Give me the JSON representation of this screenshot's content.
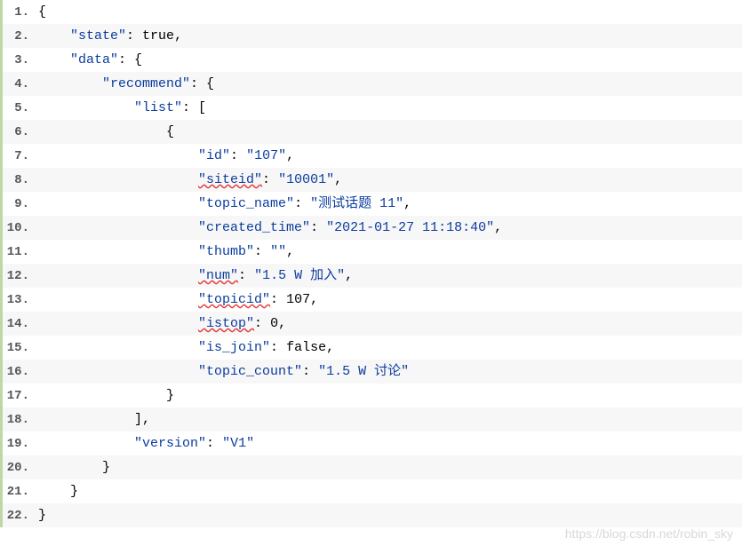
{
  "lines": [
    {
      "no": "1.",
      "indent": 0,
      "tokens": [
        {
          "t": "punc",
          "v": "{"
        }
      ]
    },
    {
      "no": "2.",
      "indent": 1,
      "tokens": [
        {
          "t": "key",
          "v": "\"state\""
        },
        {
          "t": "punc",
          "v": ": "
        },
        {
          "t": "val",
          "v": "true"
        },
        {
          "t": "punc",
          "v": ","
        }
      ]
    },
    {
      "no": "3.",
      "indent": 1,
      "tokens": [
        {
          "t": "key",
          "v": "\"data\""
        },
        {
          "t": "punc",
          "v": ": {"
        }
      ]
    },
    {
      "no": "4.",
      "indent": 2,
      "tokens": [
        {
          "t": "key",
          "v": "\"recommend\""
        },
        {
          "t": "punc",
          "v": ": {"
        }
      ]
    },
    {
      "no": "5.",
      "indent": 3,
      "tokens": [
        {
          "t": "key",
          "v": "\"list\""
        },
        {
          "t": "punc",
          "v": ": ["
        }
      ]
    },
    {
      "no": "6.",
      "indent": 4,
      "tokens": [
        {
          "t": "punc",
          "v": "{"
        }
      ]
    },
    {
      "no": "7.",
      "indent": 5,
      "tokens": [
        {
          "t": "key",
          "v": "\"id\""
        },
        {
          "t": "punc",
          "v": ": "
        },
        {
          "t": "str",
          "v": "\"107\""
        },
        {
          "t": "punc",
          "v": ","
        }
      ]
    },
    {
      "no": "8.",
      "indent": 5,
      "tokens": [
        {
          "t": "key-u",
          "v": "\"siteid\""
        },
        {
          "t": "punc",
          "v": ": "
        },
        {
          "t": "str",
          "v": "\"10001\""
        },
        {
          "t": "punc",
          "v": ","
        }
      ]
    },
    {
      "no": "9.",
      "indent": 5,
      "tokens": [
        {
          "t": "key",
          "v": "\"topic_name\""
        },
        {
          "t": "punc",
          "v": ": "
        },
        {
          "t": "str",
          "v": "\"测试话题 11\""
        },
        {
          "t": "punc",
          "v": ","
        }
      ]
    },
    {
      "no": "10.",
      "indent": 5,
      "tokens": [
        {
          "t": "key",
          "v": "\"created_time\""
        },
        {
          "t": "punc",
          "v": ": "
        },
        {
          "t": "str",
          "v": "\"2021-01-27 11:18:40\""
        },
        {
          "t": "punc",
          "v": ","
        }
      ]
    },
    {
      "no": "11.",
      "indent": 5,
      "tokens": [
        {
          "t": "key",
          "v": "\"thumb\""
        },
        {
          "t": "punc",
          "v": ": "
        },
        {
          "t": "str",
          "v": "\"\""
        },
        {
          "t": "punc",
          "v": ","
        }
      ]
    },
    {
      "no": "12.",
      "indent": 5,
      "tokens": [
        {
          "t": "key-u",
          "v": "\"num\""
        },
        {
          "t": "punc",
          "v": ": "
        },
        {
          "t": "str",
          "v": "\"1.5 W 加入\""
        },
        {
          "t": "punc",
          "v": ","
        }
      ]
    },
    {
      "no": "13.",
      "indent": 5,
      "tokens": [
        {
          "t": "key-u",
          "v": "\"topicid\""
        },
        {
          "t": "punc",
          "v": ": "
        },
        {
          "t": "num",
          "v": "107"
        },
        {
          "t": "punc",
          "v": ","
        }
      ]
    },
    {
      "no": "14.",
      "indent": 5,
      "tokens": [
        {
          "t": "key-u",
          "v": "\"istop\""
        },
        {
          "t": "punc",
          "v": ": "
        },
        {
          "t": "num",
          "v": "0"
        },
        {
          "t": "punc",
          "v": ","
        }
      ]
    },
    {
      "no": "15.",
      "indent": 5,
      "tokens": [
        {
          "t": "key",
          "v": "\"is_join\""
        },
        {
          "t": "punc",
          "v": ": "
        },
        {
          "t": "val",
          "v": "false"
        },
        {
          "t": "punc",
          "v": ","
        }
      ]
    },
    {
      "no": "16.",
      "indent": 5,
      "tokens": [
        {
          "t": "key",
          "v": "\"topic_count\""
        },
        {
          "t": "punc",
          "v": ": "
        },
        {
          "t": "str",
          "v": "\"1.5 W 讨论\""
        }
      ]
    },
    {
      "no": "17.",
      "indent": 4,
      "tokens": [
        {
          "t": "punc",
          "v": "}"
        }
      ]
    },
    {
      "no": "18.",
      "indent": 3,
      "tokens": [
        {
          "t": "punc",
          "v": "],"
        }
      ]
    },
    {
      "no": "19.",
      "indent": 3,
      "tokens": [
        {
          "t": "key",
          "v": "\"version\""
        },
        {
          "t": "punc",
          "v": ": "
        },
        {
          "t": "str",
          "v": "\"V1\""
        }
      ]
    },
    {
      "no": "20.",
      "indent": 2,
      "tokens": [
        {
          "t": "punc",
          "v": "}"
        }
      ]
    },
    {
      "no": "21.",
      "indent": 1,
      "tokens": [
        {
          "t": "punc",
          "v": "}"
        }
      ]
    },
    {
      "no": "22.",
      "indent": 0,
      "tokens": [
        {
          "t": "punc",
          "v": "}"
        }
      ]
    }
  ],
  "indent_unit": "    ",
  "watermark": "https://blog.csdn.net/robin_sky"
}
